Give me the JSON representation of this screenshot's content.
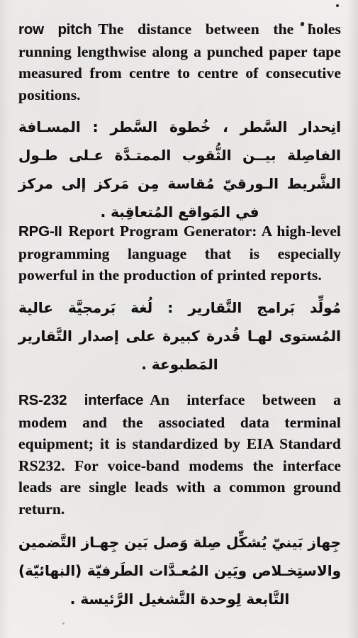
{
  "page": {
    "background_color": "#f0efed",
    "ink_color": "#111111",
    "document_type": "english-arabic technical dictionary page"
  },
  "entries": [
    {
      "id": "row-pitch",
      "headword": "row pitch",
      "english_definition": "The distance between the holes running lengthwise along a punched paper tape measured from centre to centre of consecutive positions.",
      "arabic_translation": "انِحدار السَّطر ، خُطوة السَّطر : المسـافة الفاصِلة بيــن الثُّقوب الممتـدَّة عـلى طـول الشَّريط الـورقيّ مُقاسة مِن مَركز إلى مركز في المَواقع المُتعاقِبة ."
    },
    {
      "id": "rpg2",
      "headword": "RPG-II",
      "english_definition": "Report Program Generator: A high-level programming language that is especially powerful in the production of printed reports.",
      "arabic_translation": "مُولِّد بَرامج التَّقارير : لُغة بَرمجيَّة عالية المُستوى لهـا قُدرة كبيرة على إصدار التَّقارير المَطبوعة ."
    },
    {
      "id": "rs232",
      "headword": "RS-232 interface",
      "english_definition": "An interface between a modem and the associated data terminal equipment; it is standardized by EIA Standard RS232. For voice-band modems the interface leads are single leads with a common ground return.",
      "arabic_translation": "جِهاز بَينيّ يُشكِّل صِلة وَصل بَين جِهـاز التَّضمين والاستِخـلاص ويَين المُعـدَّات الطَرفيّة (النهائيّة) التَّابعة لِوحدة التَّشغيل الرَّئيسة ."
    }
  ]
}
